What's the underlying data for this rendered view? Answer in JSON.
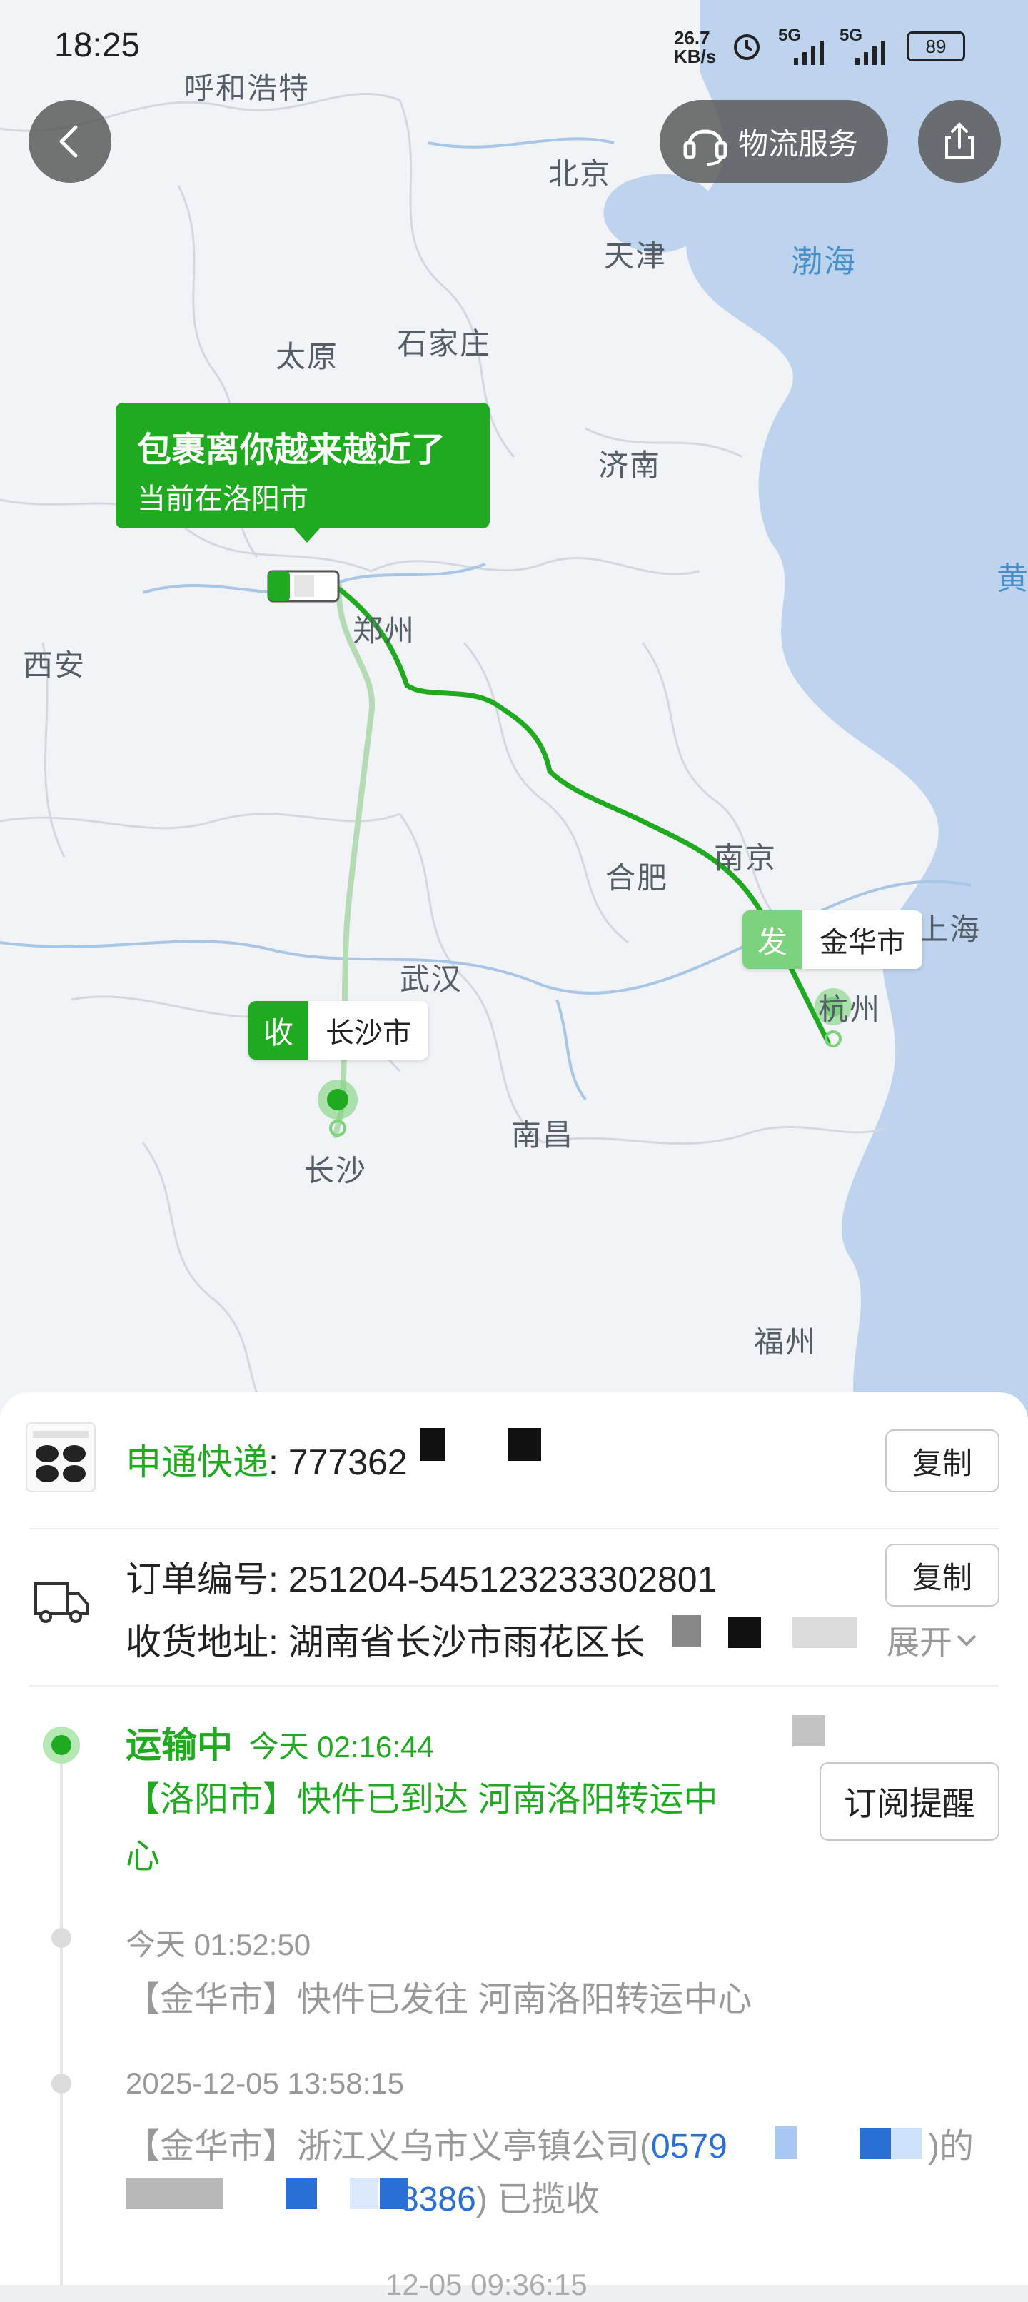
{
  "status_bar": {
    "time": "18:25",
    "net_speed_top": "26.7",
    "net_speed_bottom": "KB/s",
    "signal_1": "5G",
    "signal_2": "5G",
    "battery": "89"
  },
  "top_bar": {
    "back_icon": "chevron-left-icon",
    "service_label": "物流服务",
    "service_icon": "headset-icon",
    "share_icon": "share-icon"
  },
  "map": {
    "cities": [
      "呼和浩特",
      "北京",
      "天津",
      "石家庄",
      "太原",
      "济南",
      "郑州",
      "西安",
      "合肥",
      "南京",
      "武汉",
      "长沙",
      "南昌",
      "杭州",
      "上海",
      "福州"
    ],
    "seas": [
      "渤海",
      "黄"
    ],
    "bubble_title": "包裹离你越来越近了",
    "bubble_sub": "当前在洛阳市",
    "origin_key": "发",
    "origin_city": "金华市",
    "dest_key": "收",
    "dest_city": "长沙市",
    "route_color": "#1faa1f"
  },
  "shipment": {
    "carrier": "申通快递",
    "tracking_prefix": ": 777362",
    "copy_label": "复制",
    "order_label": "订单编号: 251204-545123233302801",
    "copy_label_2": "复制",
    "address_label": "收货地址: 湖南省长沙市雨花区长",
    "expand_label": "展开"
  },
  "timeline": {
    "current_status": "运输中",
    "current_time": "今天 02:16:44",
    "current_desc_line1": "【洛阳市】快件已到达 河南洛阳转运中",
    "current_desc_line2": "心",
    "subscribe_label": "订阅提醒",
    "event2_time": "今天 01:52:50",
    "event2_desc": "【金华市】快件已发往 河南洛阳转运中心",
    "event3_time": "2025-12-05 13:58:15",
    "event3_desc_a": "【金华市】浙江义乌市义亭镇公司(",
    "event3_phone_a": "0579",
    "event3_desc_b": ")的",
    "event3_phone_b": "8386",
    "event3_desc_c": ") 已揽收",
    "event4_time": "12-05 09:36:15"
  },
  "colors": {
    "green": "#1faa1f",
    "light_green": "#7dd37d",
    "grey_text": "#999999",
    "link_blue": "#2a6fd6"
  }
}
